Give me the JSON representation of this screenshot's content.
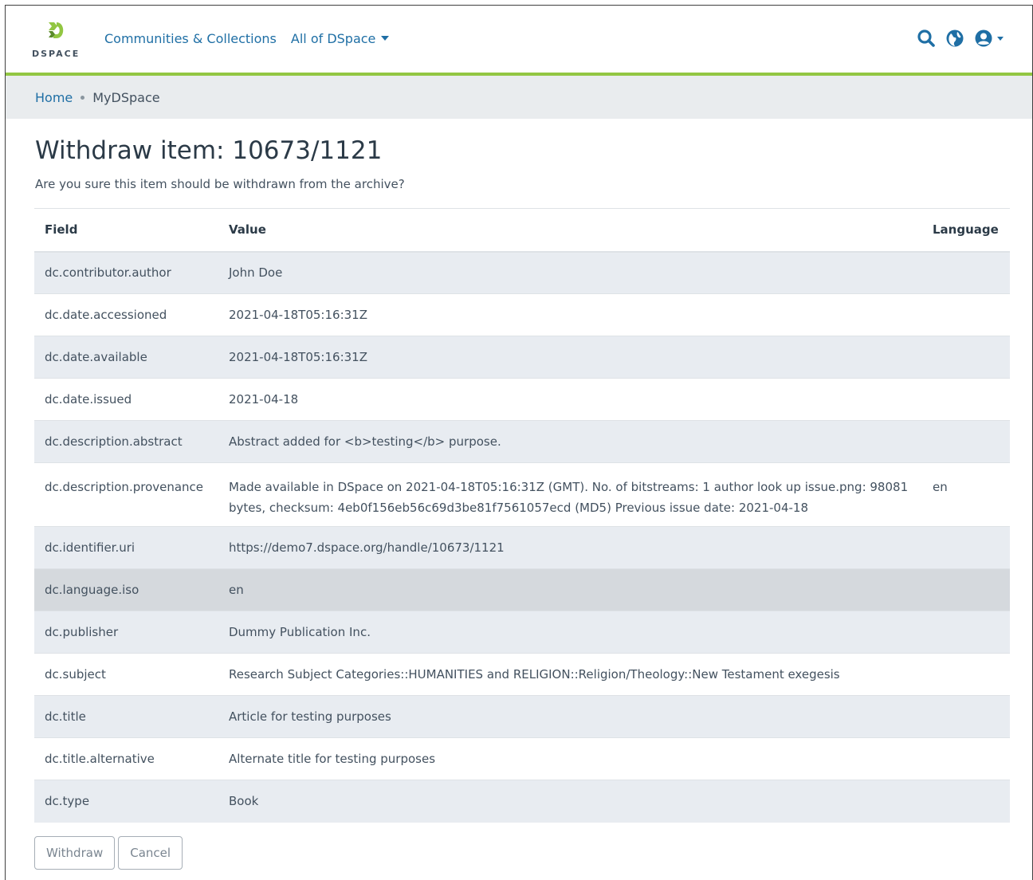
{
  "header": {
    "logo_text": "DSPACE",
    "nav": [
      {
        "label": "Communities & Collections"
      },
      {
        "label": "All of DSpace"
      }
    ],
    "icons": [
      "search-icon",
      "globe-icon",
      "user-icon"
    ]
  },
  "breadcrumb": {
    "home": "Home",
    "current": "MyDSpace"
  },
  "page": {
    "title": "Withdraw item: 10673/1121",
    "subtitle": "Are you sure this item should be withdrawn from the archive?"
  },
  "table": {
    "headers": {
      "field": "Field",
      "value": "Value",
      "language": "Language"
    },
    "rows": [
      {
        "field": "dc.contributor.author",
        "value": "John Doe",
        "language": ""
      },
      {
        "field": "dc.date.accessioned",
        "value": "2021-04-18T05:16:31Z",
        "language": ""
      },
      {
        "field": "dc.date.available",
        "value": "2021-04-18T05:16:31Z",
        "language": ""
      },
      {
        "field": "dc.date.issued",
        "value": "2021-04-18",
        "language": ""
      },
      {
        "field": "dc.description.abstract",
        "value": "Abstract added for <b>testing</b> purpose.",
        "language": ""
      },
      {
        "field": "dc.description.provenance",
        "value": "Made available in DSpace on 2021-04-18T05:16:31Z (GMT). No. of bitstreams: 1 author look up issue.png: 98081 bytes, checksum: 4eb0f156eb56c69d3be81f7561057ecd (MD5) Previous issue date: 2021-04-18",
        "language": "en"
      },
      {
        "field": "dc.identifier.uri",
        "value": "https://demo7.dspace.org/handle/10673/1121",
        "language": ""
      },
      {
        "field": "dc.language.iso",
        "value": "en",
        "language": ""
      },
      {
        "field": "dc.publisher",
        "value": "Dummy Publication Inc.",
        "language": ""
      },
      {
        "field": "dc.subject",
        "value": "Research Subject Categories::HUMANITIES and RELIGION::Religion/Theology::New Testament exegesis",
        "language": ""
      },
      {
        "field": "dc.title",
        "value": "Article for testing purposes",
        "language": ""
      },
      {
        "field": "dc.title.alternative",
        "value": "Alternate title for testing purposes",
        "language": ""
      },
      {
        "field": "dc.type",
        "value": "Book",
        "language": ""
      }
    ]
  },
  "actions": {
    "withdraw": "Withdraw",
    "cancel": "Cancel"
  },
  "colors": {
    "accent": "#92c642",
    "link": "#1f6fa5",
    "stripe": "#e8ecf1",
    "hover": "#d5d9dd"
  }
}
